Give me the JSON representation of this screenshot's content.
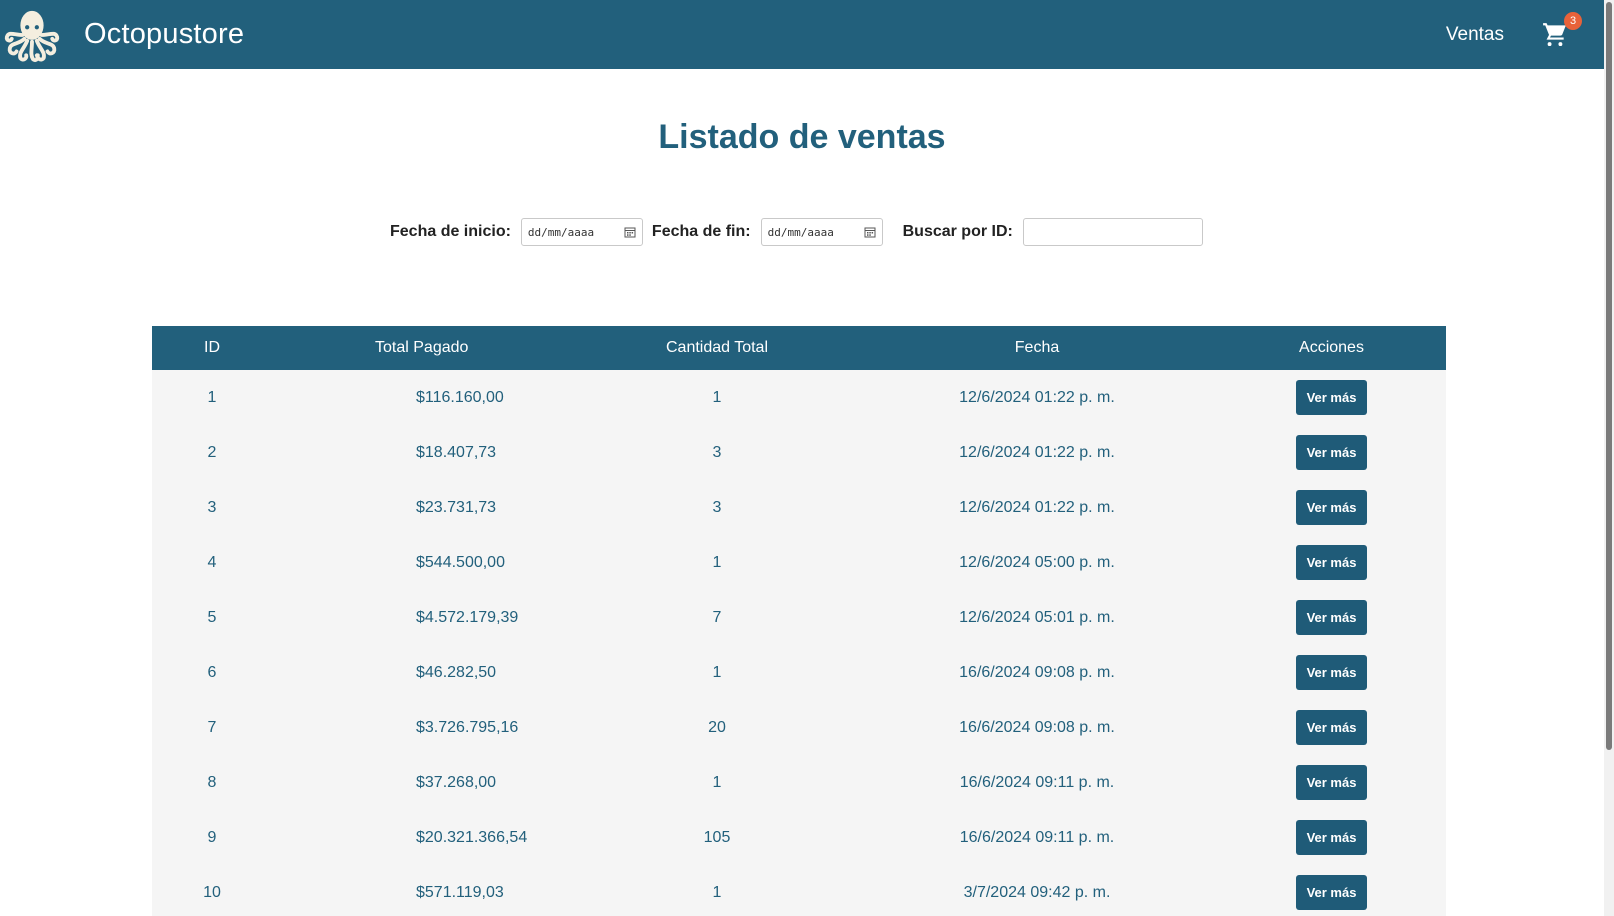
{
  "navbar": {
    "brand": "Octopustore",
    "nav_link": "Ventas",
    "cart_count": "3",
    "cart_icon": "shopping-cart-icon",
    "logo_icon": "octopus-logo-icon",
    "bg_color": "#22607c"
  },
  "main": {
    "title": "Listado de ventas"
  },
  "filters": {
    "start_label": "Fecha de inicio:",
    "start_placeholder": "dd/mm/aaaa",
    "end_label": "Fecha de fin:",
    "end_placeholder": "dd/mm/aaaa",
    "search_label": "Buscar por ID:",
    "search_value": ""
  },
  "table": {
    "headers": [
      "ID",
      "Total Pagado",
      "Cantidad Total",
      "Fecha",
      "Acciones"
    ],
    "action_label": "Ver más",
    "rows": [
      {
        "id": "1",
        "total": "$116.160,00",
        "qty": "1",
        "date": "12/6/2024 01:22 p. m."
      },
      {
        "id": "2",
        "total": "$18.407,73",
        "qty": "3",
        "date": "12/6/2024 01:22 p. m."
      },
      {
        "id": "3",
        "total": "$23.731,73",
        "qty": "3",
        "date": "12/6/2024 01:22 p. m."
      },
      {
        "id": "4",
        "total": "$544.500,00",
        "qty": "1",
        "date": "12/6/2024 05:00 p. m."
      },
      {
        "id": "5",
        "total": "$4.572.179,39",
        "qty": "7",
        "date": "12/6/2024 05:01 p. m."
      },
      {
        "id": "6",
        "total": "$46.282,50",
        "qty": "1",
        "date": "16/6/2024 09:08 p. m."
      },
      {
        "id": "7",
        "total": "$3.726.795,16",
        "qty": "20",
        "date": "16/6/2024 09:08 p. m."
      },
      {
        "id": "8",
        "total": "$37.268,00",
        "qty": "1",
        "date": "16/6/2024 09:11 p. m."
      },
      {
        "id": "9",
        "total": "$20.321.366,54",
        "qty": "105",
        "date": "16/6/2024 09:11 p. m."
      },
      {
        "id": "10",
        "total": "$571.119,03",
        "qty": "1",
        "date": "3/7/2024 09:42 p. m."
      }
    ]
  }
}
